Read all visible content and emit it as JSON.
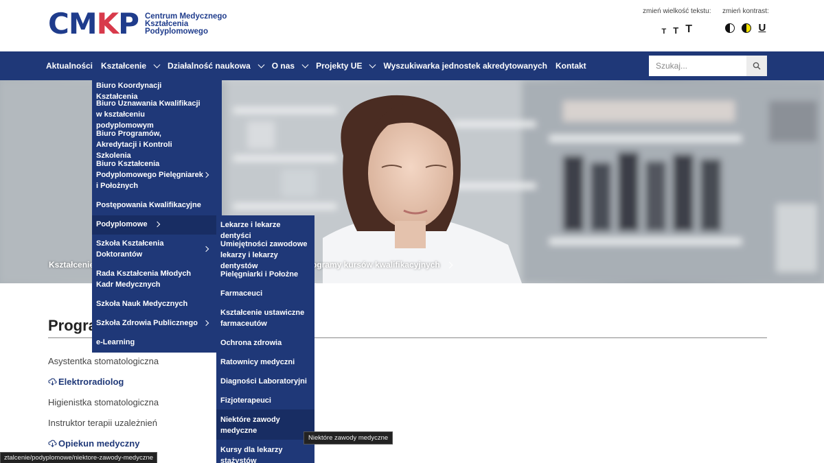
{
  "logo": {
    "mark_a": "CM",
    "mark_b": "K",
    "mark_c": "P",
    "line1": "Centrum Medycznego",
    "line2": "Kształcenia",
    "line3": "Podyplomowego"
  },
  "accessibility": {
    "font_size_label": "zmień wielkość tekstu:",
    "font_small": "T",
    "font_medium": "T",
    "font_large": "T",
    "contrast_label": "zmień kontrast:",
    "contrast_underline": "U"
  },
  "nav": {
    "items": [
      {
        "label": "Aktualności",
        "dropdown": false
      },
      {
        "label": "Kształcenie",
        "dropdown": true
      },
      {
        "label": "Działalność naukowa",
        "dropdown": true
      },
      {
        "label": "O nas",
        "dropdown": true
      },
      {
        "label": "Projekty UE",
        "dropdown": true
      },
      {
        "label": "Wyszukiwarka jednostek akredytowanych",
        "dropdown": false
      },
      {
        "label": "Kontakt",
        "dropdown": false
      }
    ],
    "search_placeholder": "Szukaj..."
  },
  "breadcrumb": {
    "first": "Kształcenie",
    "last": "ogramy kursów kwalifikacyjnych"
  },
  "dropdown_primary": [
    {
      "label": "Biuro Koordynacji Kształcenia",
      "submenu": false
    },
    {
      "label": "Biuro Uznawania Kwalifikacji w kształceniu podyplomowym",
      "submenu": false
    },
    {
      "label": "Biuro Programów, Akredytacji i Kontroli Szkolenia",
      "submenu": false
    },
    {
      "label": "Biuro Kształcenia Podyplomowego Pielęgniarek i Położnych",
      "submenu": true
    },
    {
      "label": "Postępowania Kwalifikacyjne",
      "submenu": false
    },
    {
      "label": "Podyplomowe",
      "submenu": true
    },
    {
      "label": "Szkoła Kształcenia Doktorantów",
      "submenu": true
    },
    {
      "label": "Rada Kształcenia Młodych Kadr Medycznych",
      "submenu": false
    },
    {
      "label": "Szkoła Nauk Medycznych",
      "submenu": false
    },
    {
      "label": "Szkoła Zdrowia Publicznego",
      "submenu": true
    },
    {
      "label": "e-Learning",
      "submenu": false
    }
  ],
  "dropdown_secondary": [
    {
      "label": "Lekarze i lekarze dentyści"
    },
    {
      "label": "Umiejętności zawodowe lekarzy i lekarzy dentystów"
    },
    {
      "label": "Pielęgniarki i Położne"
    },
    {
      "label": "Farmaceuci"
    },
    {
      "label": "Kształcenie ustawiczne farmaceutów"
    },
    {
      "label": "Ochrona zdrowia"
    },
    {
      "label": "Ratownicy medyczni"
    },
    {
      "label": "Diagności Laboratoryjni"
    },
    {
      "label": "Fizjoterapeuci"
    },
    {
      "label": "Niektóre zawody medyczne"
    },
    {
      "label": "Kursy dla lekarzy stażystów"
    }
  ],
  "content": {
    "title": "Progra",
    "professions": [
      {
        "label": "Asystentka stomatologiczna",
        "download": false
      },
      {
        "label": "Elektroradiolog",
        "download": true
      },
      {
        "label": "Higienistka stomatologiczna",
        "download": false
      },
      {
        "label": "Instruktor terapii uzależnień",
        "download": false
      },
      {
        "label": "Opiekun medyczny",
        "download": true
      }
    ]
  },
  "tooltip": "Niektóre zawody medyczne",
  "status_url": "ztalcenie/podyplomowe/niektore-zawody-medyczne",
  "colors": {
    "brand_blue": "#1f3878",
    "logo_blue": "#1f3c8c",
    "logo_red": "#d83a4b",
    "highlight": "#182d63"
  }
}
